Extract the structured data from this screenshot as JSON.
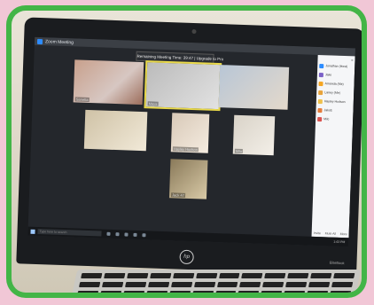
{
  "zoom": {
    "title": "Zoom Meeting",
    "banner": "Remaining Meeting Time: 39:47 | Upgrade to Pro",
    "tiles": [
      {
        "name": "Sanetta"
      },
      {
        "name": "Maya"
      },
      {
        "name": ""
      },
      {
        "name": ""
      },
      {
        "name": "Hayley Hudson"
      },
      {
        "name": "Milo"
      },
      {
        "name": ""
      },
      {
        "name": "Jack 47"
      }
    ],
    "participants": [
      {
        "label": "Jonathan (Host)",
        "color": "#2d8cff"
      },
      {
        "label": "Jake",
        "color": "#7b61c7"
      },
      {
        "label": "Amanda (Me)",
        "color": "#f5a623"
      },
      {
        "label": "Laney (Me)",
        "color": "#e8a33a"
      },
      {
        "label": "Hayley Hudson",
        "color": "#f0c14b"
      },
      {
        "label": "Jakob",
        "color": "#e57c3a"
      },
      {
        "label": "Milo",
        "color": "#d9534f"
      }
    ],
    "panel_footer": {
      "invite": "Invite",
      "mute_all": "Mute All",
      "more": "More"
    }
  },
  "taskbar": {
    "search_placeholder": "Type here to search",
    "clock": "1:43 PM"
  },
  "laptop": {
    "brand": "hp",
    "model": "EliteBook"
  }
}
